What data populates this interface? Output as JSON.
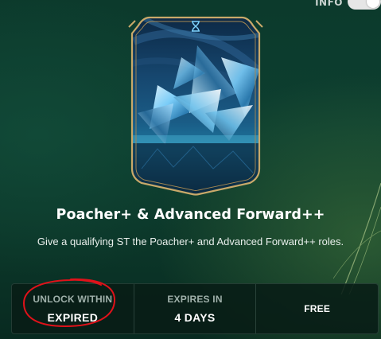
{
  "header": {
    "toggle_label": "INFO",
    "toggle_state": "on"
  },
  "card": {
    "name": "Poacher+ & Advanced Forward++",
    "icon": "evolution-icon",
    "description": "Give a qualifying ST the Poacher+ and Advanced Forward++ roles.",
    "frame_color": "#c9a96a",
    "accent_color": "#7fd3ff"
  },
  "stats": {
    "unlock_label": "UNLOCK WITHIN",
    "unlock_value": "EXPIRED",
    "expires_label": "EXPIRES IN",
    "expires_value": "4 DAYS",
    "cost_value": "FREE"
  },
  "annotation": {
    "color": "#e0121a"
  }
}
